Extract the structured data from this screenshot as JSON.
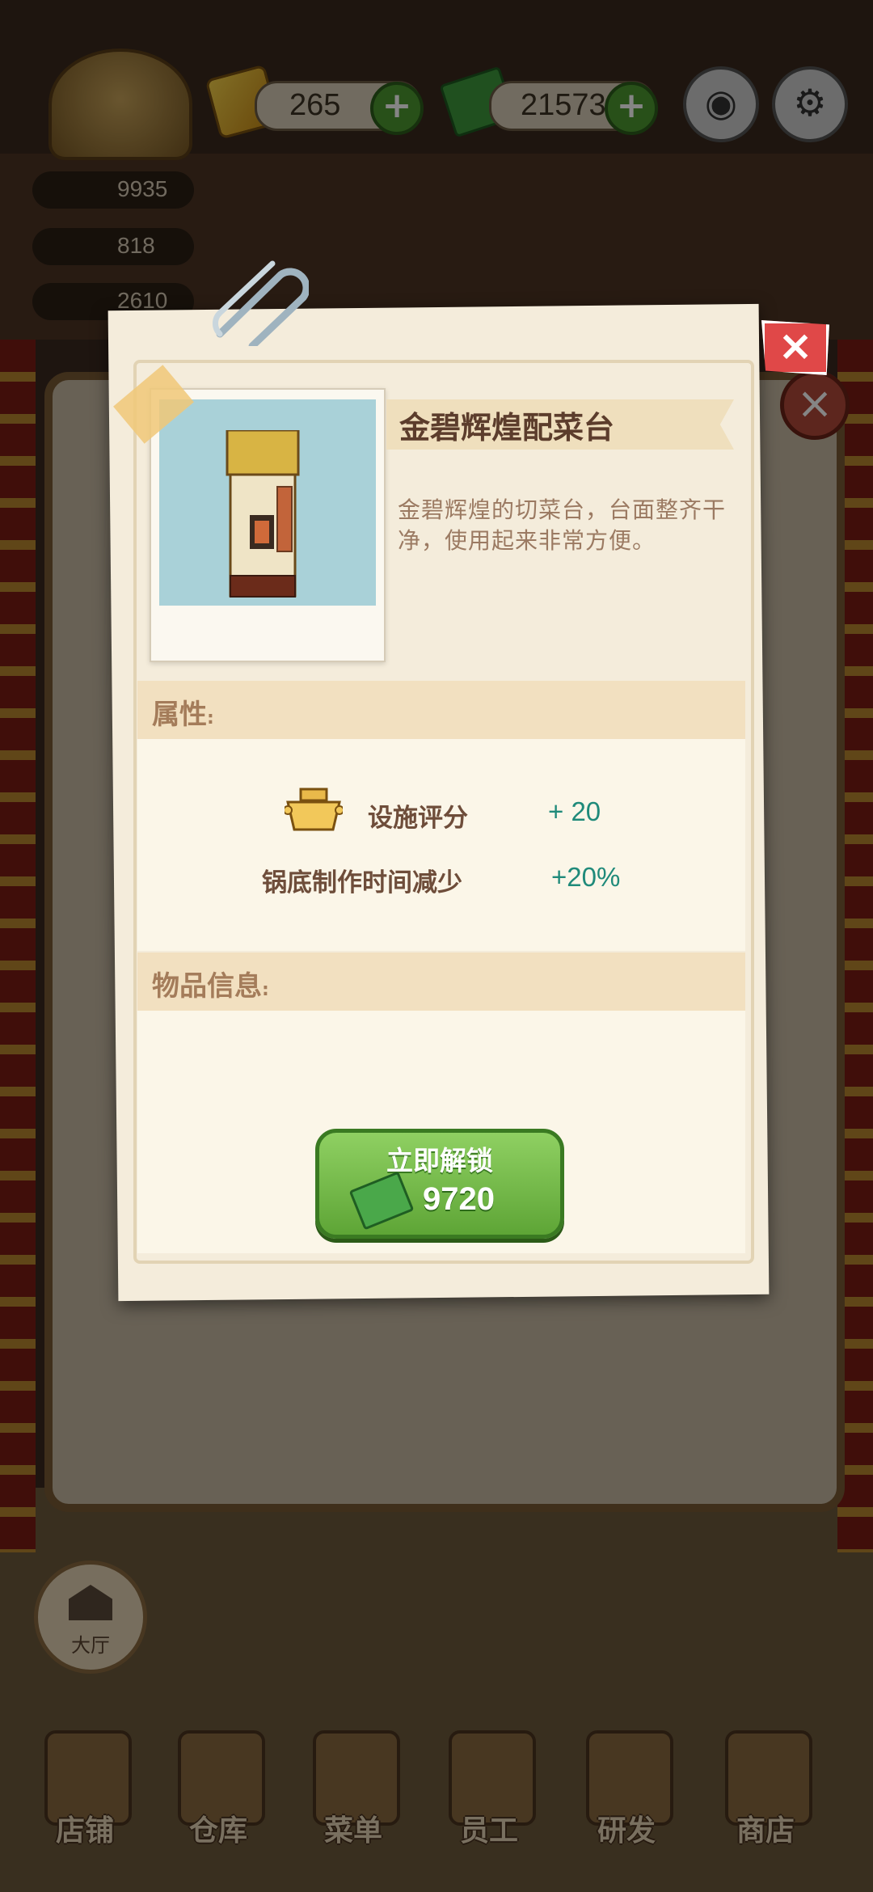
{
  "resources": {
    "gems": "265",
    "cash": "21573"
  },
  "stats": {
    "rating": "9935",
    "service": "818",
    "menu": "2610"
  },
  "modal": {
    "title": "金碧辉煌配菜台",
    "description": "金碧辉煌的切菜台，台面整齐干净，使用起来非常方便。",
    "attributes_label": "属性",
    "attributes_colon": ":",
    "attributes": [
      {
        "name": "设施评分",
        "value": "+ 20",
        "icon": "golden-pot-icon"
      },
      {
        "name": "锅底制作时间减少",
        "value": "+20%"
      }
    ],
    "info_label": "物品信息",
    "info_colon": ":",
    "unlock_label": "立即解锁",
    "unlock_price": "9720"
  },
  "hall_button": "大厅",
  "bottom_nav": [
    {
      "label": "店铺",
      "icon": "shop-icon"
    },
    {
      "label": "仓库",
      "icon": "warehouse-icon"
    },
    {
      "label": "菜单",
      "icon": "menu-clipboard-icon"
    },
    {
      "label": "员工",
      "icon": "staff-icon"
    },
    {
      "label": "研发",
      "icon": "research-wok-icon"
    },
    {
      "label": "商店",
      "icon": "store-icon"
    }
  ],
  "colors": {
    "accent_green": "#5ea536",
    "close_red": "#e04848",
    "value_teal": "#1f8a7a",
    "title_brown": "#5c3d2c"
  }
}
